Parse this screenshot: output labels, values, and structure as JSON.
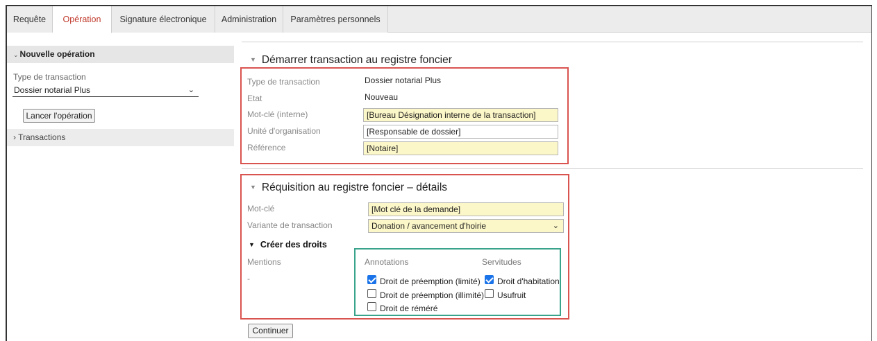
{
  "tabs": [
    {
      "label": "Requête"
    },
    {
      "label": "Opération"
    },
    {
      "label": "Signature électronique"
    },
    {
      "label": "Administration"
    },
    {
      "label": "Paramètres personnels"
    }
  ],
  "sidebar": {
    "new_op_title": "Nouvelle opération",
    "type_label": "Type de transaction",
    "type_value": "Dossier notarial Plus",
    "launch_button": "Lancer l'opération",
    "transactions_title": "Transactions"
  },
  "section1": {
    "title": "Démarrer transaction au registre foncier",
    "rows": [
      {
        "label": "Type de transaction",
        "value": "Dossier notarial Plus"
      },
      {
        "label": "Etat",
        "value": "Nouveau"
      },
      {
        "label": "Mot-clé (interne)",
        "value": "[Bureau Désignation interne de la transaction]"
      },
      {
        "label": "Unité d'organisation",
        "value": "[Responsable de dossier]"
      },
      {
        "label": "Référence",
        "value": "[Notaire]"
      }
    ]
  },
  "section2": {
    "title": "Réquisition au registre foncier – détails",
    "keyword_label": "Mot-clé",
    "keyword_value": "[Mot clé de la demande]",
    "variant_label": "Variante de transaction",
    "variant_value": "Donation / avancement d'hoirie",
    "rights_title": "Créer des droits",
    "mentions_label": "Mentions",
    "mentions_value": "-",
    "annotations_label": "Annotations",
    "servitudes_label": "Servitudes",
    "annotations": [
      {
        "label": "Droit de préemption (limité)",
        "checked": true
      },
      {
        "label": "Droit de préemption (illimité)",
        "checked": false
      },
      {
        "label": "Droit de réméré",
        "checked": false
      }
    ],
    "servitudes": [
      {
        "label": "Droit d'habitation",
        "checked": true
      },
      {
        "label": "Usufruit",
        "checked": false
      }
    ]
  },
  "continue_button": "Continuer",
  "colors": {
    "active_tab": "#c0392b",
    "highlight_box": "#d9534f",
    "rights_box": "#3aa38c",
    "field_yellow": "#fcf7c8",
    "checkbox": "#1a73e8"
  }
}
